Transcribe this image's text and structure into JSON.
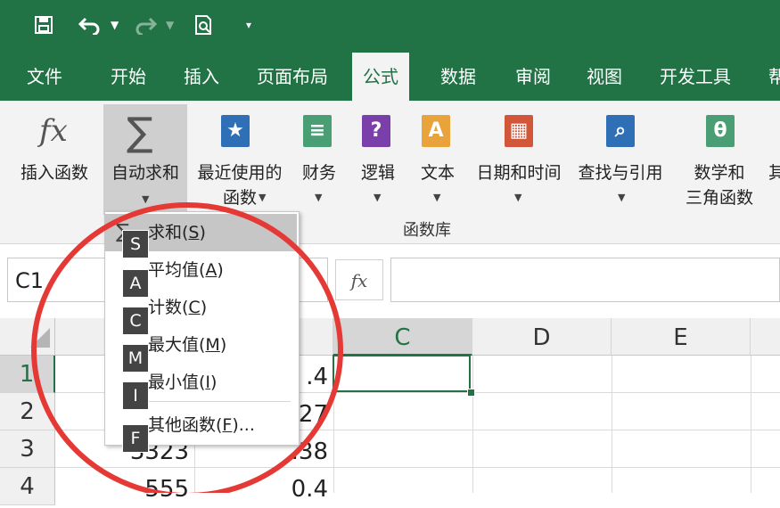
{
  "qat": {
    "undo_icon": "undo-icon",
    "redo_icon": "redo-icon",
    "save_icon": "save-icon",
    "preview_icon": "print-preview-icon",
    "customize_icon": "customize-qat-icon"
  },
  "tabs": [
    "文件",
    "开始",
    "插入",
    "页面布局",
    "公式",
    "数据",
    "审阅",
    "视图",
    "开发工具",
    "帮"
  ],
  "active_tab": "公式",
  "ribbon": {
    "insert_function": {
      "icon": "fx",
      "label": "插入函数"
    },
    "autosum": {
      "icon": "∑",
      "label": "自动求和"
    },
    "recent": {
      "icon": "★",
      "label1": "最近使用的",
      "label2": "函数"
    },
    "financial": {
      "label": "财务"
    },
    "logical": {
      "icon": "?",
      "label": "逻辑"
    },
    "text": {
      "icon": "A",
      "label": "文本"
    },
    "datetime": {
      "label": "日期和时间"
    },
    "lookup": {
      "label": "查找与引用"
    },
    "math": {
      "icon": "θ",
      "label1": "数学和",
      "label2": "三角函数"
    },
    "more": {
      "label": "其"
    },
    "group_label": "函数库",
    "colors": {
      "recent": "#2f6fb5",
      "financial": "#4a9e73",
      "logical": "#7a3fa8",
      "text": "#e8a33a",
      "datetime": "#d2573a",
      "lookup": "#2f6fb5",
      "math": "#4a9e73"
    }
  },
  "namebox": "C1",
  "fx_label": "fx",
  "columns": [
    "C",
    "D",
    "E"
  ],
  "rows": [
    "1",
    "2",
    "3",
    "4"
  ],
  "cells": {
    "r1": ".4",
    "r2": "27",
    "r3a": "3323",
    "r3b": ".38",
    "r4a": "555",
    "r4b": "0.4"
  },
  "menu": {
    "sigma": "∑",
    "items": [
      {
        "label": "求和(",
        "key": "S",
        "tail": ")",
        "keytip": "S"
      },
      {
        "label": "平均值(",
        "key": "A",
        "tail": ")",
        "keytip": "A"
      },
      {
        "label": "计数(",
        "key": "C",
        "tail": ")",
        "keytip": "C"
      },
      {
        "label": "最大值(",
        "key": "M",
        "tail": ")",
        "keytip": "M"
      },
      {
        "label": "最小值(",
        "key": "I",
        "tail": ")",
        "keytip": "I"
      },
      {
        "label": "其他函数(",
        "key": "F",
        "tail": ")...",
        "keytip": "F"
      }
    ]
  },
  "colors": {
    "accent": "#217346",
    "annotation": "#e53935"
  }
}
